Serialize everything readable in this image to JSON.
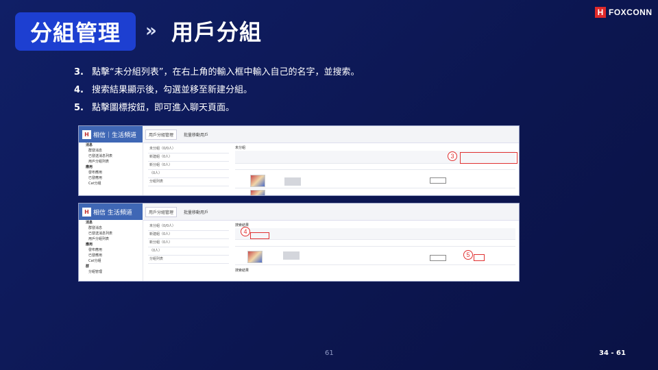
{
  "header": {
    "title": "分組管理",
    "chevron": "»",
    "subtitle": "用戶分組",
    "logo_text": "FOXCONN",
    "logo_mark": "H"
  },
  "steps": [
    {
      "num": "3.",
      "text": "點擊“未分組列表”，在右上角的輸入框中輸入自己的名字，並搜索。"
    },
    {
      "num": "4.",
      "text": "搜索結果顯示後，勾選並移至新建分組。"
    },
    {
      "num": "5.",
      "text": "點擊圖標按鈕，即可進入聊天頁面。"
    }
  ],
  "screenshot1": {
    "app_title": "相信｜生活頻道",
    "tabs": [
      "用戶分組管理",
      "批量移動用戶"
    ],
    "marker": "3",
    "sidebar": [
      "消息",
      "群發消息",
      "已發送消息列表",
      "用戶分組列表",
      "應用",
      "發布應用",
      "已發應用",
      "Cat分組"
    ],
    "list": [
      "未分組（0/0人）",
      "新建組（0人）",
      "新分組（0人）",
      "（0人）",
      "分組列表"
    ],
    "main_title": "未分組"
  },
  "screenshot2": {
    "app_title": "相信 生活頻道",
    "tabs": [
      "用戶分組管理",
      "批量移動用戶"
    ],
    "marker4": "4",
    "marker5": "5",
    "sidebar": [
      "消息",
      "群發消息",
      "已發送消息列表",
      "用戶分組列表",
      "應用",
      "發布應用",
      "已發應用",
      "Cat分組",
      "群",
      "分組管理"
    ],
    "list": [
      "未分組（0/0人）",
      "新建組（0人）",
      "新分組（0人）",
      "（0人）",
      "分組列表"
    ],
    "main_title": "搜索結果",
    "footer_label": "搜索結果"
  },
  "footer": {
    "page": "61",
    "count": "34 - 61"
  }
}
